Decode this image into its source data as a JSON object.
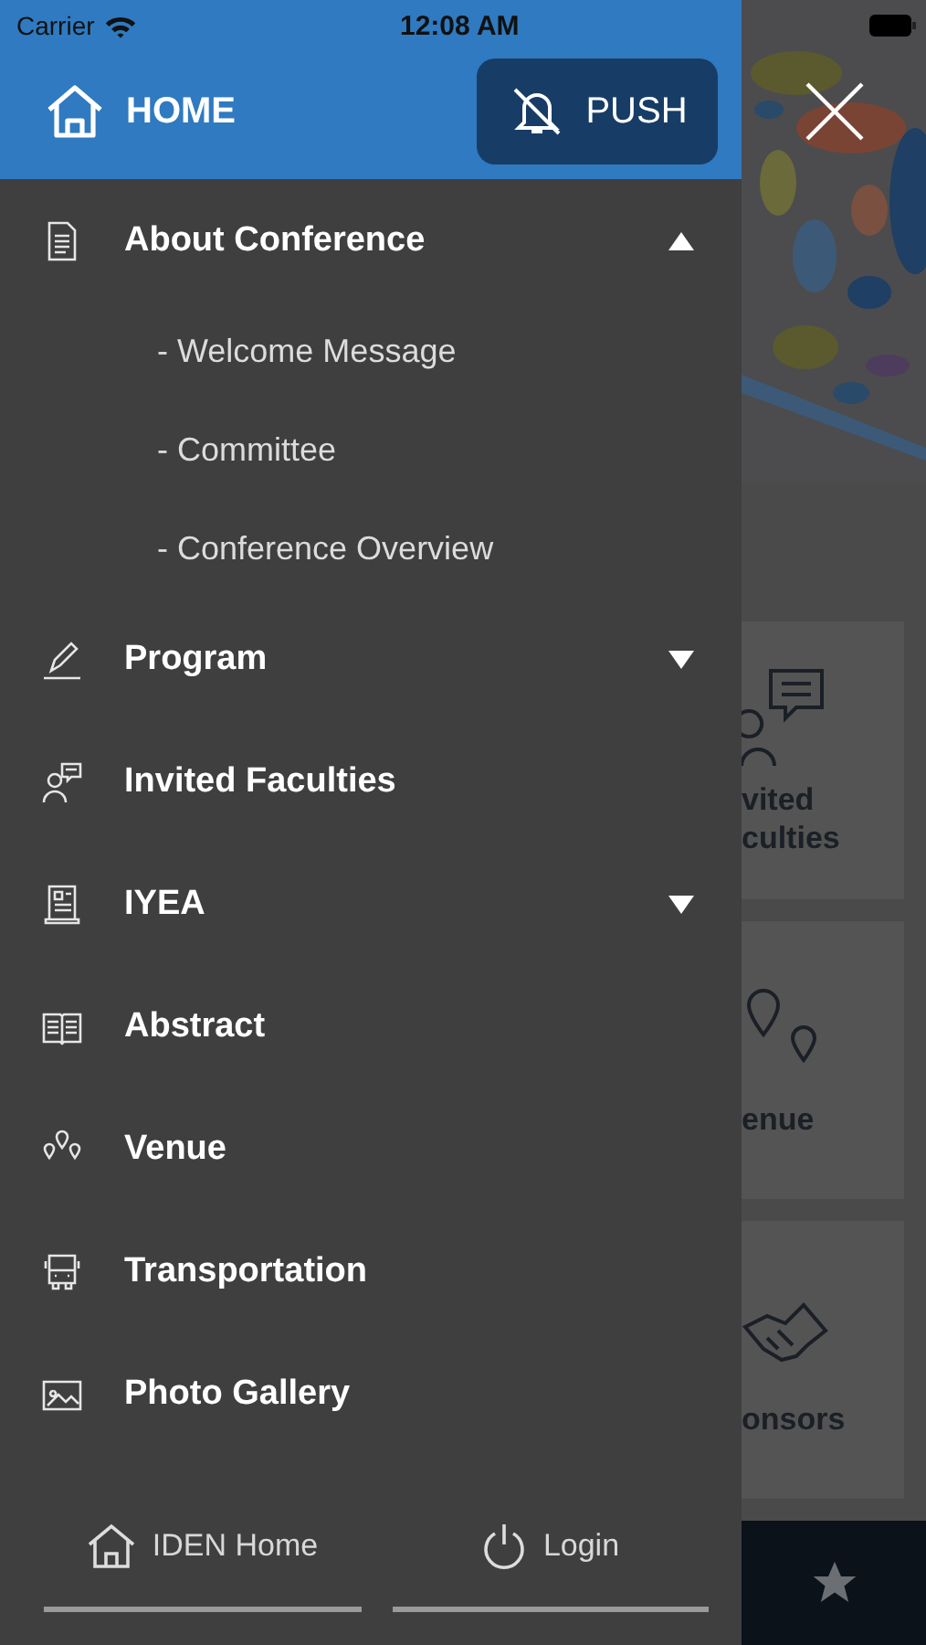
{
  "status_bar": {
    "carrier": "Carrier",
    "time": "12:08 AM"
  },
  "header": {
    "home_label": "HOME",
    "push_label": "PUSH"
  },
  "menu": [
    {
      "label": "About Conference",
      "kind": "group",
      "expanded": true,
      "children": [
        {
          "label": "- Welcome Message"
        },
        {
          "label": "- Committee"
        },
        {
          "label": "- Conference Overview"
        }
      ]
    },
    {
      "label": "Program",
      "kind": "group",
      "expanded": false
    },
    {
      "label": "Invited Faculties",
      "kind": "link"
    },
    {
      "label": "IYEA",
      "kind": "group",
      "expanded": false
    },
    {
      "label": "Abstract",
      "kind": "link"
    },
    {
      "label": "Venue",
      "kind": "link"
    },
    {
      "label": "Transportation",
      "kind": "link"
    },
    {
      "label": "Photo Gallery",
      "kind": "link"
    }
  ],
  "footer": [
    {
      "label": "IDEN Home"
    },
    {
      "label": "Login"
    }
  ],
  "background_cards": [
    {
      "label_lines": [
        "vited",
        "culties"
      ]
    },
    {
      "label_lines": [
        "enue"
      ]
    },
    {
      "label_lines": [
        "onsors"
      ]
    }
  ]
}
